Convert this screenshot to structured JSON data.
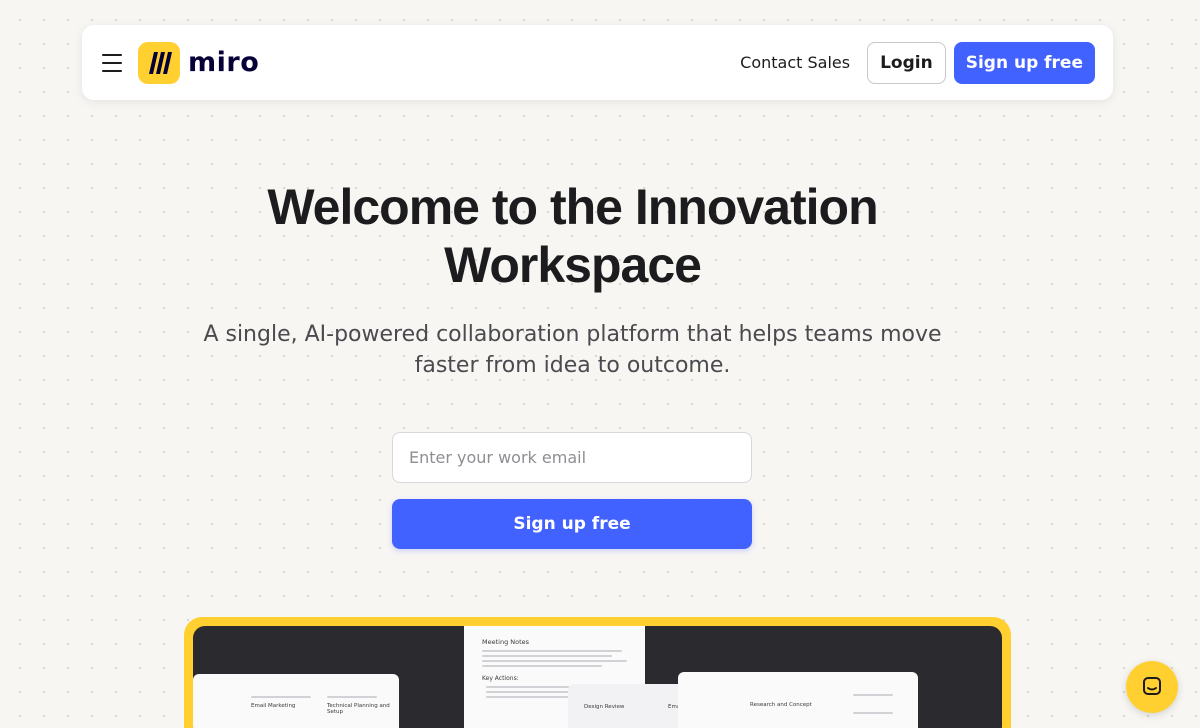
{
  "nav": {
    "logo_text": "miro",
    "contact_label": "Contact Sales",
    "login_label": "Login",
    "signup_label": "Sign up free"
  },
  "hero": {
    "title_line1": "Welcome to the Innovation",
    "title_line2": "Workspace",
    "subtitle_line1": "A single, AI-powered collaboration platform that helps teams move",
    "subtitle_line2": "faster from idea to outcome.",
    "email_placeholder": "Enter your work email",
    "signup_label": "Sign up free"
  },
  "preview": {
    "doc_title": "Meeting Notes",
    "doc_section": "Key Actions:",
    "cards": [
      "Email Marketing",
      "Technical Planning and Setup",
      "Design Review",
      "Email Marketing",
      "Research and Concept"
    ]
  },
  "icons": {
    "menu": "hamburger-icon",
    "logo": "miro-logo-icon",
    "chat": "chat-icon"
  },
  "colors": {
    "brand_yellow": "#ffd02f",
    "primary_blue": "#4262ff",
    "background": "#f8f6f3",
    "preview_dark": "#2b2a2e"
  }
}
